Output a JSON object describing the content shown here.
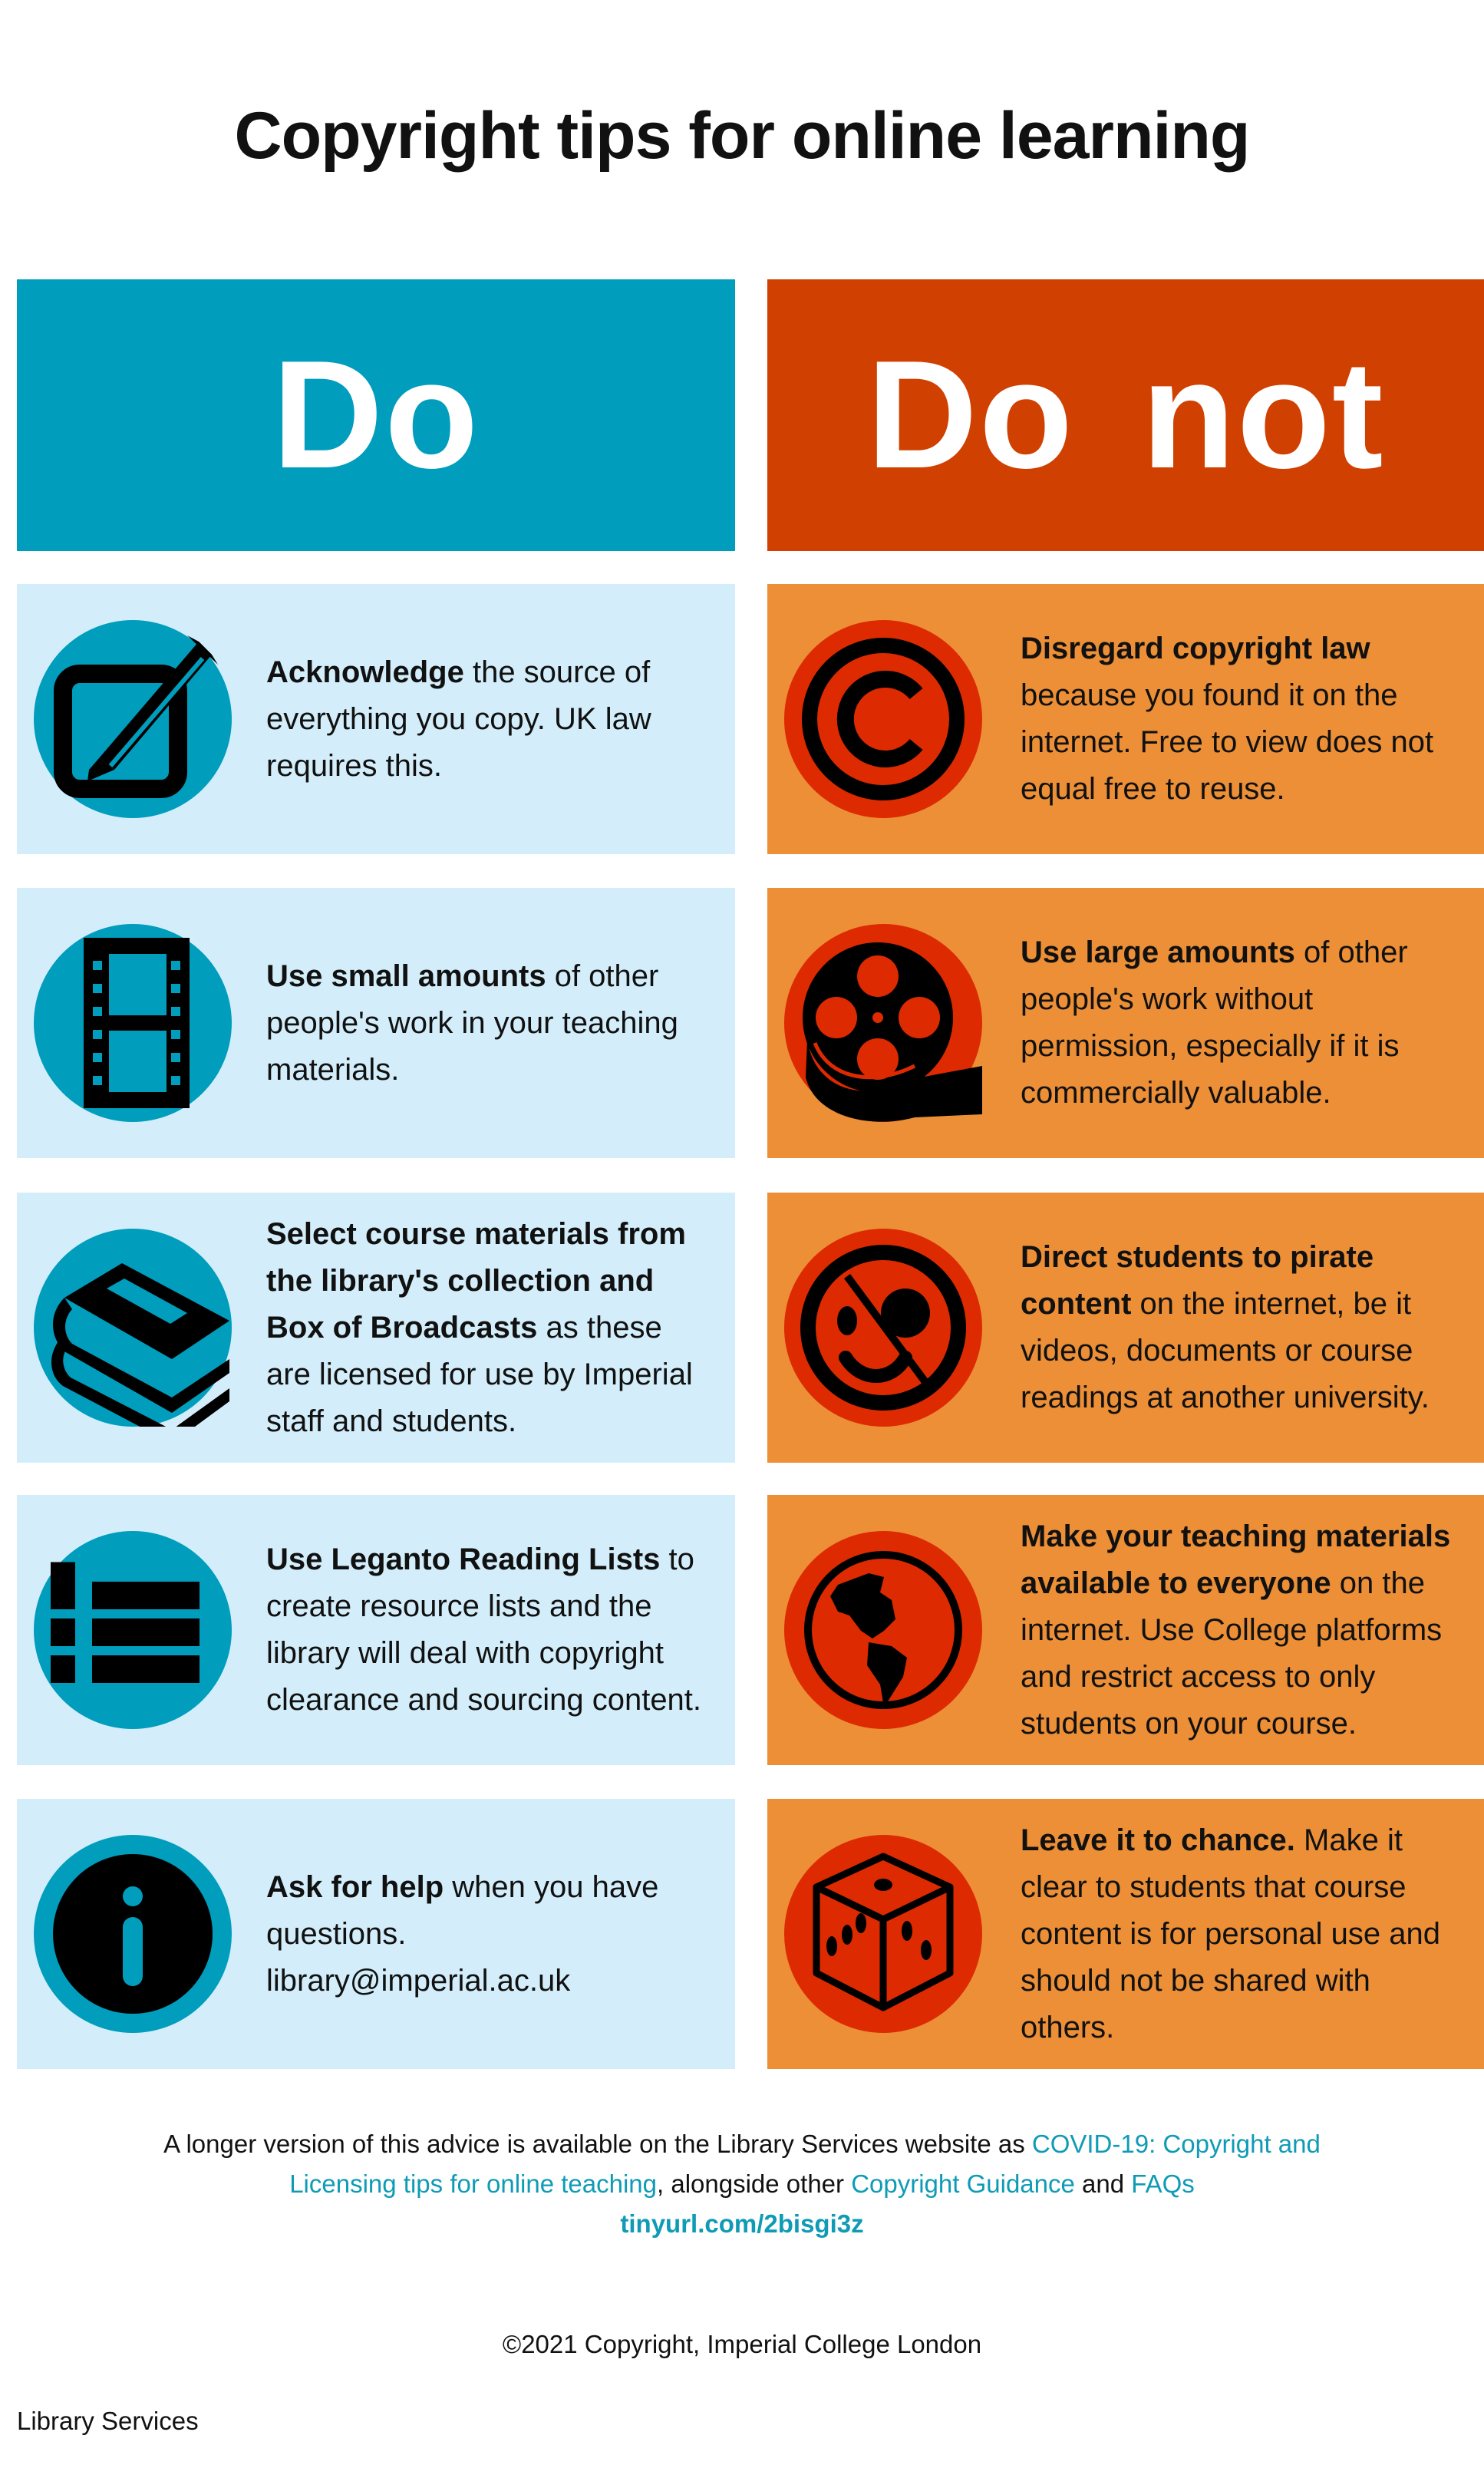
{
  "title": "Copyright tips for online learning",
  "colors": {
    "do_header": "#009dbd",
    "dont_header": "#d04000",
    "do_card": "#d3eefa",
    "dont_card": "#ec8f36",
    "do_icon_circle": "#009dbd",
    "dont_icon_circle": "#dd2a00",
    "link": "#0f9bb6"
  },
  "do": {
    "header": "Do",
    "items": [
      {
        "icon": "edit-pencil-icon",
        "bold": "Acknowledge",
        "rest": " the source of everything you copy. UK law requires this."
      },
      {
        "icon": "film-strip-icon",
        "bold": "Use small amounts",
        "rest": " of other people's work in your teaching materials."
      },
      {
        "icon": "books-icon",
        "bold": "Select course materials from the library's collection and Box of Broadcasts",
        "rest": " as these are licensed for use by Imperial staff and students."
      },
      {
        "icon": "list-icon",
        "bold": "Use Leganto Reading Lists",
        "rest": " to create resource lists and the library will deal with copyright clearance and sourcing content."
      },
      {
        "icon": "info-icon",
        "bold": "Ask for help",
        "rest": " when you have questions.",
        "extra": "library@imperial.ac.uk"
      }
    ]
  },
  "dont": {
    "header": "Do not",
    "items": [
      {
        "icon": "copyright-icon",
        "bold": "Disregard copyright law",
        "rest": " because you found it on the internet. Free to view does not equal free to reuse."
      },
      {
        "icon": "film-reel-icon",
        "bold": "Use large amounts",
        "rest": " of other people's work without permission, especially if it is commercially valuable."
      },
      {
        "icon": "pirate-face-icon",
        "bold": "Direct students to pirate content",
        "rest": " on the internet, be it videos, documents or course readings at another university."
      },
      {
        "icon": "globe-icon",
        "bold": "Make your teaching materials available to everyone",
        "rest": " on the internet. Use College platforms and restrict access to only students on your course."
      },
      {
        "icon": "dice-icon",
        "bold": "Leave it to chance.",
        "rest": " Make it clear to students that course content is for personal use and should not be shared with others."
      }
    ]
  },
  "footer": {
    "intro": "A longer version of this advice is available on the Library Services website as ",
    "link1": "COVID-19: Copyright and Licensing tips for online teaching",
    "mid": ", alongside other ",
    "link2": "Copyright Guidance",
    "and": " and ",
    "link3": "FAQs",
    "short_url": "tinyurl.com/2bisgi3z",
    "copyright": "©2021 Copyright, Imperial College London",
    "org": "Library Services"
  }
}
